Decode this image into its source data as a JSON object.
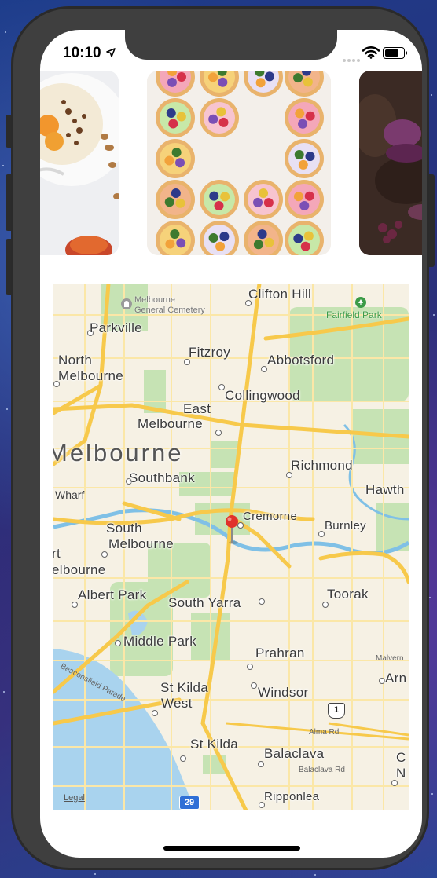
{
  "status_bar": {
    "time": "10:10"
  },
  "carousel": {
    "cards": [
      {
        "name": "yogurt-bowl"
      },
      {
        "name": "fruit-tarts"
      },
      {
        "name": "dark-dessert"
      }
    ]
  },
  "map": {
    "legal_link": "Legal",
    "city_label": "Melbourne",
    "suburbs": {
      "clifton_hill": "Clifton Hill",
      "parkville": "Parkville",
      "fitzroy": "Fitzroy",
      "north_melbourne_1": "North",
      "north_melbourne_2": "Melbourne",
      "abbotsford": "Abbotsford",
      "collingwood": "Collingwood",
      "east_melbourne_1": "East",
      "east_melbourne_2": "Melbourne",
      "richmond": "Richmond",
      "southbank": "Southbank",
      "hawthorn": "Hawth",
      "wharf": "Wharf",
      "cremorne": "Cremorne",
      "burnley": "Burnley",
      "south_melbourne_1": "South",
      "south_melbourne_2": "Melbourne",
      "port_melbourne_1": "rt",
      "port_melbourne_2": "elbourne",
      "albert_park": "Albert Park",
      "south_yarra": "South Yarra",
      "toorak": "Toorak",
      "middle_park": "Middle Park",
      "prahran": "Prahran",
      "armadale": "Arn",
      "st_kilda_west_1": "St Kilda",
      "st_kilda_west_2": "West",
      "windsor": "Windsor",
      "st_kilda": "St Kilda",
      "balaclava": "Balaclava",
      "caulfield_1": "C",
      "caulfield_2": "N",
      "ripponlea": "Ripponlea"
    },
    "points_of_interest": {
      "cemetery_1": "Melbourne",
      "cemetery_2": "General Cemetery",
      "fairfield_park": "Fairfield Park"
    },
    "streets": {
      "beaconsfield": "Beaconsfield Parade",
      "malvern": "Malvern",
      "alma": "Alma Rd",
      "balaclava_rd": "Balaclava Rd"
    },
    "route_shields": {
      "route_1": "1",
      "route_29": "29"
    }
  },
  "colors": {
    "water": "#a9d3ee",
    "park": "#c6e3b4",
    "major_road": "#f7c94b",
    "minor_road": "#fbe7a7",
    "pin": "#e0322b"
  }
}
